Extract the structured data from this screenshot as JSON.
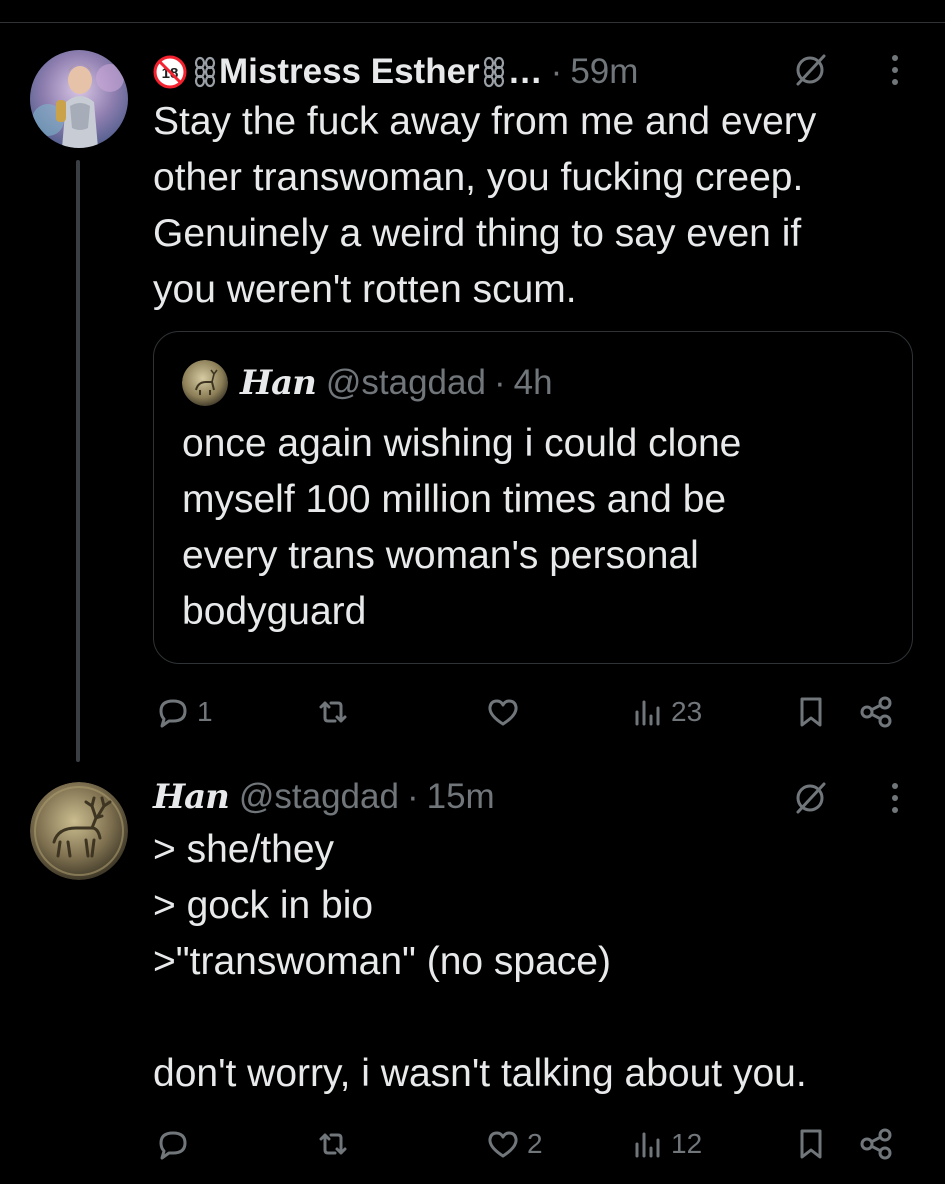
{
  "thread": {
    "posts": [
      {
        "author_name": "Mistress Esther",
        "name_truncation": "…",
        "separator": "·",
        "time": "59m",
        "text": "Stay the fuck away from me and every\nother transwoman, you fucking creep.\nGenuinely a weird thing to say even if\nyou weren't rotten scum.",
        "badges": [
          "no-under-18-icon",
          "chain-icon"
        ],
        "quote": {
          "author_name": "Han",
          "handle": "@stagdad",
          "separator": "·",
          "time": "4h",
          "text": "once again wishing i could clone\nmyself 100 million times and be\nevery trans woman's personal\nbodyguard"
        },
        "actions": {
          "reply_count": "1",
          "repost_count": "",
          "like_count": "",
          "views_count": "23"
        }
      },
      {
        "author_name": "Han",
        "handle": "@stagdad",
        "separator": "·",
        "time": "15m",
        "text": "> she/they\n> gock in bio\n>\"transwoman\" (no space)\n\ndon't worry, i wasn't talking about you.",
        "actions": {
          "reply_count": "",
          "repost_count": "",
          "like_count": "2",
          "views_count": "12"
        }
      }
    ]
  },
  "colors": {
    "background": "#000000",
    "text_primary": "#e7e9ea",
    "text_muted": "#71767b",
    "border": "#2f3336",
    "nsfw_red": "#f4212e"
  },
  "icons": {
    "reply": "speech-bubble-icon",
    "repost": "repost-arrows-icon",
    "like": "heart-icon",
    "views": "bar-chart-icon",
    "bookmark": "bookmark-icon",
    "share": "share-icon",
    "grok": "grok-icon",
    "more": "vertical-dots-icon"
  }
}
